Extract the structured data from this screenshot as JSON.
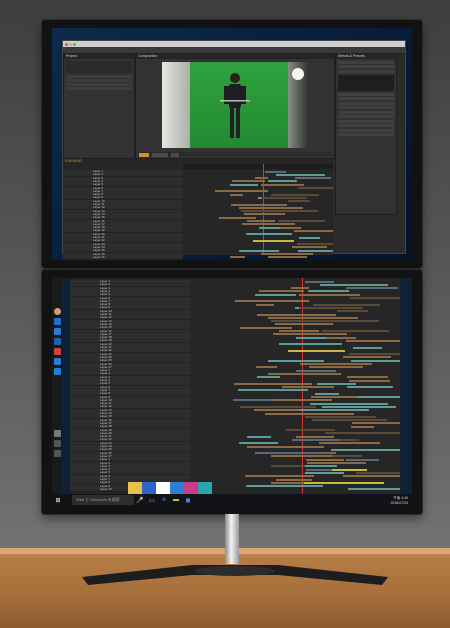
{
  "top_monitor": {
    "app": {
      "window_title": "",
      "panels": {
        "project": "Project",
        "composition": "Composition",
        "effects": "Effects & Presets",
        "timeline": "Timeline"
      },
      "timecode": "0:00:00:00",
      "layer_names": [
        "Layer 1",
        "Layer 2",
        "Layer 3",
        "Layer 4",
        "Layer 5",
        "Layer 6",
        "Layer 7",
        "Layer 8",
        "Layer 9",
        "Layer 10",
        "Layer 11",
        "Layer 12",
        "Layer 13",
        "Layer 14",
        "Layer 15",
        "Layer 16",
        "Layer 17",
        "Layer 18",
        "Layer 19",
        "Layer 20",
        "Layer 21",
        "Layer 22",
        "Layer 23",
        "Layer 24",
        "Layer 25",
        "Layer 26",
        "Layer 27"
      ]
    }
  },
  "bottom_monitor": {
    "taskbar": {
      "search_placeholder": "Web と Windows を検索",
      "clock_time": "午後 4:40",
      "clock_date": "2015/07/23"
    },
    "sidebar_icons": [
      "avatar",
      "mail-icon",
      "calendar-icon",
      "people-icon",
      "store-icon",
      "weather-icon",
      "news-icon",
      "sports-icon",
      "phone-icon"
    ]
  },
  "colors": {
    "bar_teal": "#5e9a96",
    "bar_brown": "#8a6a45",
    "bar_dark_brown": "#5a4a38",
    "bar_slate": "#5a6a7a",
    "bar_yellow": "#c9b840",
    "ae_bg": "#2b2b2b",
    "green_screen": "#2fa23e"
  }
}
